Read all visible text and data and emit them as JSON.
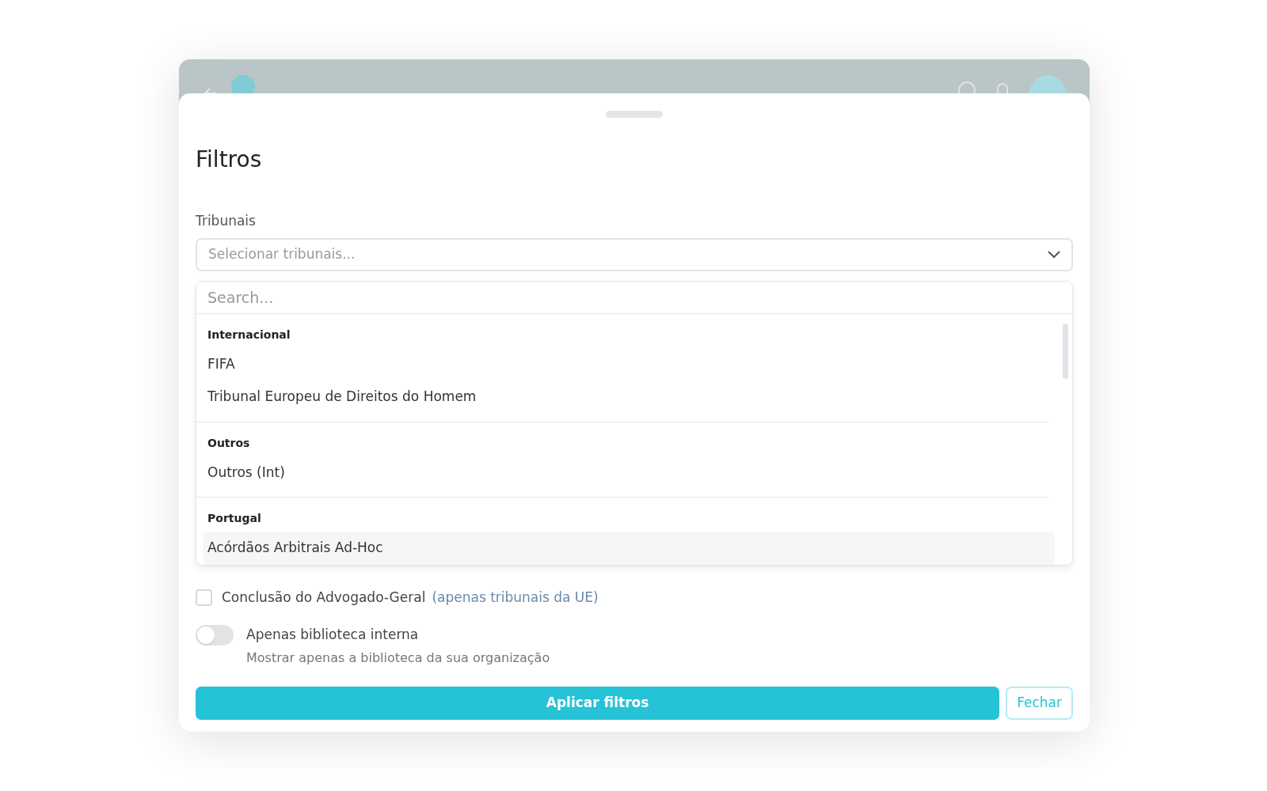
{
  "sheet": {
    "title": "Filtros",
    "courts": {
      "label": "Tribunais",
      "placeholder": "Selecionar tribunais...",
      "search_placeholder": "Search...",
      "groups": [
        {
          "name": "Internacional",
          "items": [
            {
              "label": "FIFA",
              "selected": false
            },
            {
              "label": "Tribunal Europeu de Direitos do Homem",
              "selected": false
            }
          ]
        },
        {
          "name": "Outros",
          "items": [
            {
              "label": "Outros (Int)",
              "selected": false
            }
          ]
        },
        {
          "name": "Portugal",
          "items": [
            {
              "label": "Acórdãos Arbitrais Ad-Hoc",
              "selected": true
            }
          ]
        }
      ]
    },
    "checkbox": {
      "label": "Conclusão do Advogado-Geral",
      "note": "(apenas tribunais da UE)",
      "checked": false
    },
    "toggle": {
      "label": "Apenas biblioteca interna",
      "description": "Mostrar apenas a biblioteca da sua organização",
      "on": false
    },
    "buttons": {
      "apply": "Aplicar filtros",
      "close": "Fechar"
    }
  }
}
